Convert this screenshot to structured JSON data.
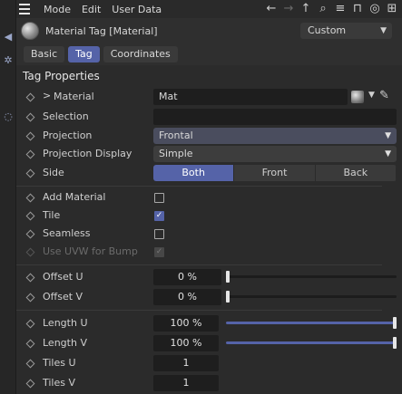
{
  "menubar": {
    "items": [
      "Mode",
      "Edit",
      "User Data"
    ]
  },
  "header": {
    "title": "Material Tag [Material]",
    "preset": "Custom"
  },
  "tabs": [
    {
      "label": "Basic",
      "active": false
    },
    {
      "label": "Tag",
      "active": true
    },
    {
      "label": "Coordinates",
      "active": false
    }
  ],
  "section_title": "Tag Properties",
  "fields": {
    "material": {
      "label": "Material",
      "value": "Mat"
    },
    "selection": {
      "label": "Selection",
      "value": ""
    },
    "projection": {
      "label": "Projection",
      "value": "Frontal"
    },
    "projection_display": {
      "label": "Projection Display",
      "value": "Simple"
    },
    "side": {
      "label": "Side",
      "options": [
        "Both",
        "Front",
        "Back"
      ],
      "selected": "Both"
    },
    "add_material": {
      "label": "Add Material",
      "checked": false
    },
    "tile": {
      "label": "Tile",
      "checked": true
    },
    "seamless": {
      "label": "Seamless",
      "checked": false
    },
    "use_uvw": {
      "label": "Use UVW for Bump",
      "checked": true,
      "disabled": true
    },
    "offset_u": {
      "label": "Offset U",
      "value": "0 %",
      "fraction": 0
    },
    "offset_v": {
      "label": "Offset V",
      "value": "0 %",
      "fraction": 0
    },
    "length_u": {
      "label": "Length U",
      "value": "100 %",
      "fraction": 1
    },
    "length_v": {
      "label": "Length V",
      "value": "100 %",
      "fraction": 1
    },
    "tiles_u": {
      "label": "Tiles U",
      "value": "1"
    },
    "tiles_v": {
      "label": "Tiles V",
      "value": "1"
    }
  },
  "colors": {
    "accent": "#5563a8",
    "background": "#2b2b2b"
  }
}
